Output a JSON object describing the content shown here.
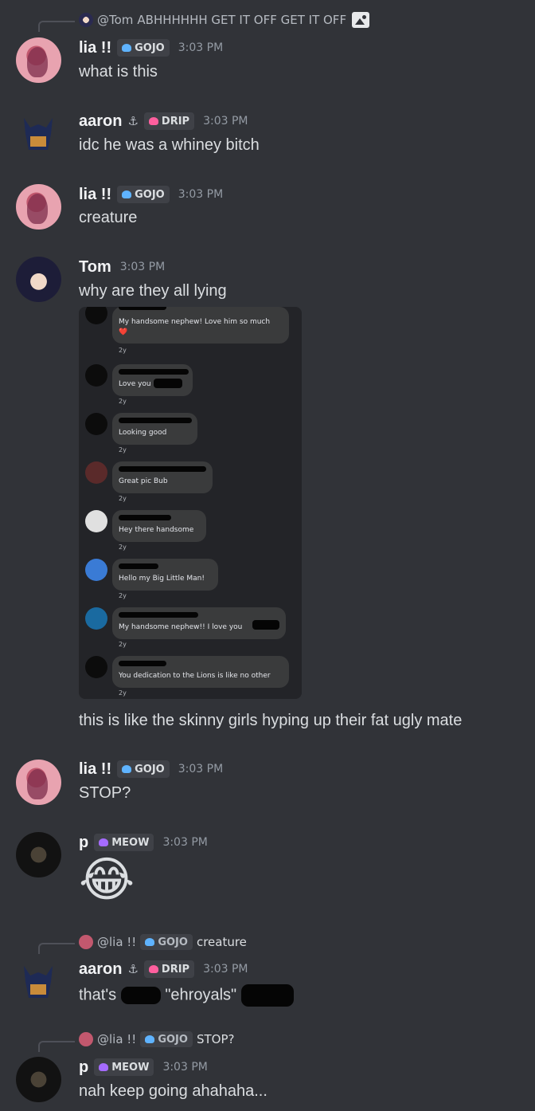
{
  "channel": {
    "messages": [
      {
        "reply": {
          "author": "@Tom",
          "text": "ABHHHHHH GET IT OFF GET IT OFF",
          "attachment_icon": "image-icon"
        },
        "author": "lia !!",
        "tag": "GOJO",
        "tag_color": "#5fb3ff",
        "time": "3:03 PM",
        "text": "what is this"
      },
      {
        "author": "aaron",
        "author_icon": "anchor-icon",
        "tag": "DRIP",
        "tag_color": "#ff5f9e",
        "time": "3:03 PM",
        "text": "idc he was a whiney bitch"
      },
      {
        "author": "lia !!",
        "tag": "GOJO",
        "tag_color": "#5fb3ff",
        "time": "3:03 PM",
        "text": "creature"
      },
      {
        "author": "Tom",
        "time": "3:03 PM",
        "text": "why are they all lying",
        "attachment": {
          "comments": [
            {
              "text_lines": [
                "My handsome nephew! Love him so much",
                "❤️"
              ],
              "age": "2y"
            },
            {
              "text_lines": [
                "Love you"
              ],
              "age": "2y"
            },
            {
              "text_lines": [
                "Looking good"
              ],
              "age": "2y"
            },
            {
              "text_lines": [
                "Great pic Bub"
              ],
              "age": "2y"
            },
            {
              "text_lines": [
                "Hey there handsome"
              ],
              "age": "2y"
            },
            {
              "text_lines": [
                "Hello my Big Little Man!"
              ],
              "age": "2y"
            },
            {
              "text_lines": [
                "My handsome nephew!! I love you"
              ],
              "age": "2y"
            },
            {
              "text_lines": [
                "You dedication to the Lions is like no other"
              ],
              "age": "2y"
            }
          ]
        },
        "text2": "this is like the skinny girls hyping up their fat ugly mate"
      },
      {
        "author": "lia !!",
        "tag": "GOJO",
        "tag_color": "#5fb3ff",
        "time": "3:03 PM",
        "text": "STOP?"
      },
      {
        "author": "p",
        "tag": "MEOW",
        "tag_color": "#a56bff",
        "time": "3:03 PM",
        "emoji": "😂"
      },
      {
        "reply": {
          "author": "@lia !!",
          "tag": "GOJO",
          "text": "creature"
        },
        "author": "aaron",
        "author_icon": "anchor-icon",
        "tag": "DRIP",
        "tag_color": "#ff5f9e",
        "time": "3:03 PM",
        "text_before": "that's",
        "text_middle": "\"ehroyals\""
      },
      {
        "reply": {
          "author": "@lia !!",
          "tag": "GOJO",
          "text": "STOP?"
        },
        "author": "p",
        "tag": "MEOW",
        "tag_color": "#a56bff",
        "time": "3:03 PM",
        "text": "nah keep going ahahaha..."
      }
    ]
  }
}
